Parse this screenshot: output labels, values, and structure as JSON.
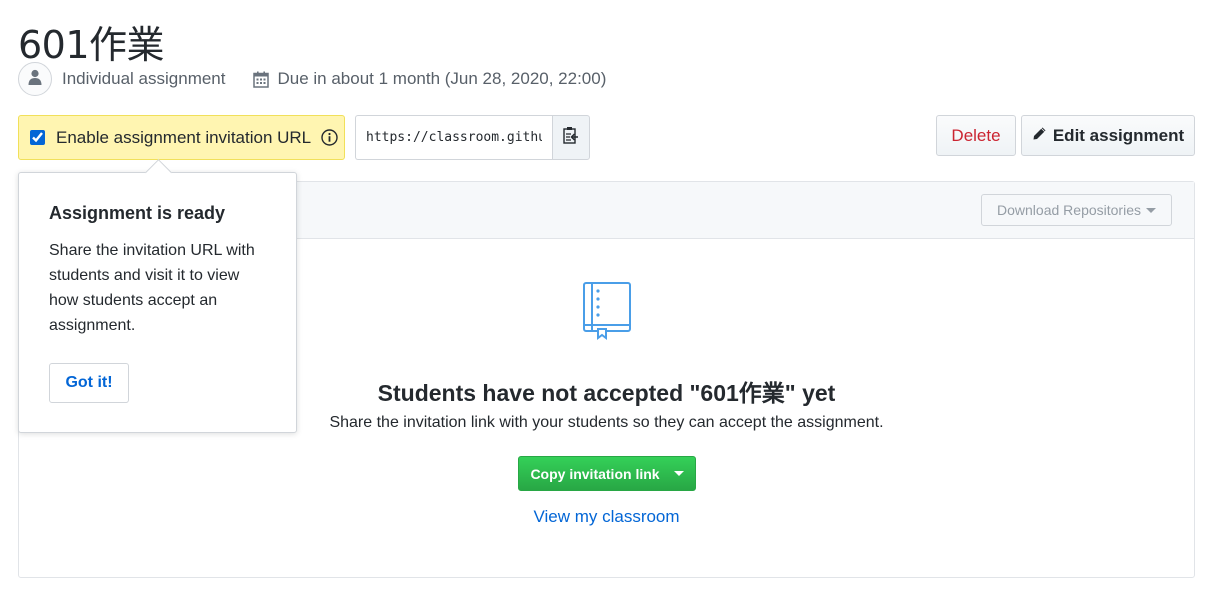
{
  "assignment": {
    "title": "601作業",
    "type_label": "Individual assignment",
    "due_label": "Due in about 1 month (Jun 28, 2020, 22:00)"
  },
  "invitation": {
    "checkbox_checked": true,
    "label": "Enable assignment invitation URL",
    "url_value": "https://classroom.github"
  },
  "actions": {
    "delete_label": "Delete",
    "edit_label": "Edit assignment"
  },
  "panel": {
    "download_label": "Download Repositories",
    "empty_title": "Students have not accepted \"601作業\" yet",
    "empty_description": "Share the invitation link with your students so they can accept the assignment.",
    "copy_label": "Copy invitation link",
    "view_link": "View my classroom"
  },
  "popover": {
    "title": "Assignment is ready",
    "body": "Share the invitation URL with students and visit it to view how students accept an assignment.",
    "button_label": "Got it!"
  },
  "colors": {
    "danger": "#cb2431",
    "link": "#0366d6",
    "success": "#28a745",
    "highlight": "#fff5b1",
    "icon_blue": "#4a9ee8"
  },
  "icons": [
    "person-icon",
    "calendar-icon",
    "info-icon",
    "clipboard-icon",
    "pencil-icon",
    "book-icon",
    "caret-down-icon"
  ]
}
